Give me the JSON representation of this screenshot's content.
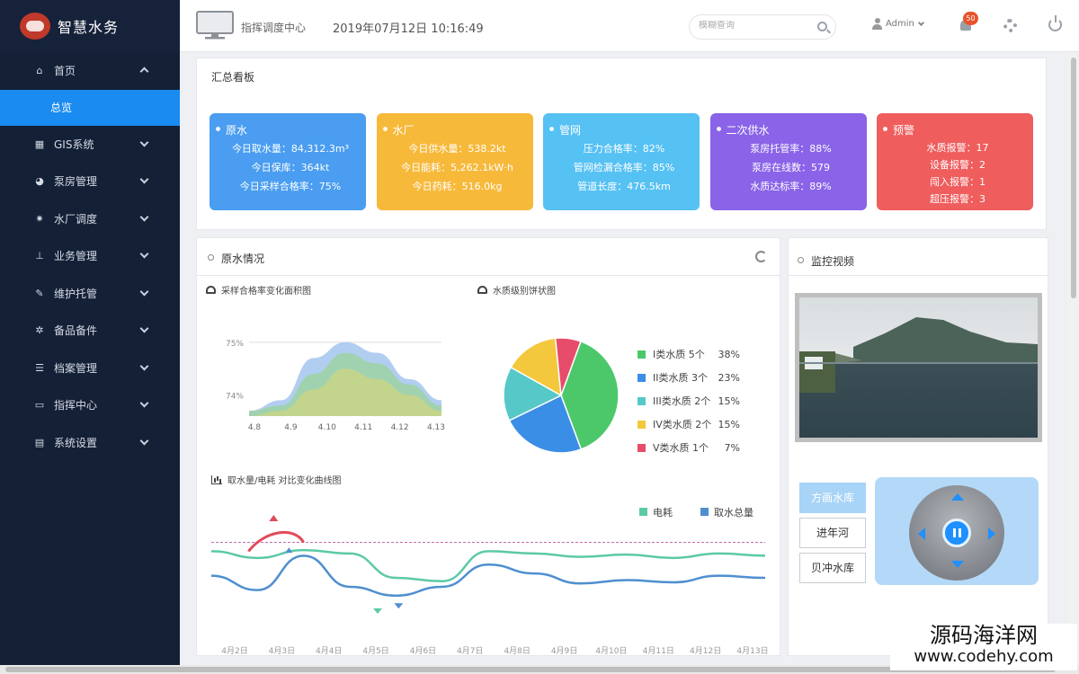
{
  "brand": {
    "title": "智慧水务"
  },
  "sidebar": {
    "items": [
      {
        "label": "首页",
        "icon": "home-icon",
        "expanded": true
      },
      {
        "label": "GIS系统",
        "icon": "grid-icon"
      },
      {
        "label": "泵房管理",
        "icon": "pie-icon"
      },
      {
        "label": "水厂调度",
        "icon": "cog-icon"
      },
      {
        "label": "业务管理",
        "icon": "sitemap-icon"
      },
      {
        "label": "维护托管",
        "icon": "edit-icon"
      },
      {
        "label": "备品备件",
        "icon": "cogs-icon"
      },
      {
        "label": "档案管理",
        "icon": "list-icon"
      },
      {
        "label": "指挥中心",
        "icon": "monitor-icon"
      },
      {
        "label": "系统设置",
        "icon": "calendar-icon"
      }
    ],
    "sub_active": "总览"
  },
  "topbar": {
    "center_name": "指挥调度中心",
    "datetime": "2019年07月12日 10:16:49",
    "search_placeholder": "模糊查询",
    "user": "Admin",
    "notifications": "50"
  },
  "summary": {
    "title": "汇总看板",
    "cards": [
      {
        "title": "原水",
        "color": "#4a9df0",
        "lines": [
          "今日取水量：84,312.3m³",
          "今日保库：364kt",
          "今日采样合格率：75%"
        ]
      },
      {
        "title": "水厂",
        "color": "#f7b93a",
        "lines": [
          "今日供水量：538.2kt",
          "今日能耗：5,262.1kW·h",
          "今日药耗：516.0kg"
        ]
      },
      {
        "title": "管网",
        "color": "#56c1f3",
        "lines": [
          "压力合格率：82%",
          "管网检漏合格率：85%",
          "管道长度：476.5km"
        ]
      },
      {
        "title": "二次供水",
        "color": "#8a63e8",
        "lines": [
          "泵房托管率：88%",
          "泵房在线数：579",
          "水质达标率：89%"
        ]
      },
      {
        "title": "预警",
        "color": "#ef5d5d",
        "lines": [
          "水质报警：17",
          "设备报警：2",
          "闯入报警：1",
          "超压报警：3"
        ]
      }
    ]
  },
  "raw_panel": {
    "title": "原水情况",
    "area_title": "采样合格率变化面积图",
    "pie_title": "水质级别饼状图",
    "line_title": "取水量/电耗 对比变化曲线图"
  },
  "video_panel": {
    "title": "监控视频",
    "video_overlay": "",
    "reservoirs": [
      "方画水库",
      "进年河",
      "贝冲水库"
    ],
    "active_reservoir": 0
  },
  "chart_data": [
    {
      "type": "area",
      "title": "采样合格率变化面积图",
      "categories": [
        "4.8",
        "4.9",
        "4.10",
        "4.11",
        "4.12",
        "4.13"
      ],
      "y_ticks": [
        "75%",
        "74%"
      ],
      "ylim": [
        73.6,
        75.1
      ],
      "series": [
        {
          "color": "#a8c9ef",
          "values": [
            73.7,
            73.9,
            74.7,
            75.0,
            74.8,
            74.3,
            73.9
          ]
        },
        {
          "color": "#9fd3a8",
          "values": [
            73.7,
            73.8,
            74.4,
            74.8,
            74.6,
            74.2,
            73.8
          ]
        },
        {
          "color": "#c7d48a",
          "values": [
            73.6,
            73.7,
            74.1,
            74.5,
            74.3,
            74.0,
            73.7
          ]
        }
      ]
    },
    {
      "type": "pie",
      "title": "水质级别饼状图",
      "slices": [
        {
          "label": "I类水质",
          "count": "5个",
          "percent": 38,
          "color": "#4cc86b"
        },
        {
          "label": "II类水质",
          "count": "3个",
          "percent": 23,
          "color": "#3a8ee6"
        },
        {
          "label": "III类水质",
          "count": "2个",
          "percent": 15,
          "color": "#56c8c8"
        },
        {
          "label": "IV类水质",
          "count": "2个",
          "percent": 15,
          "color": "#f4c83c"
        },
        {
          "label": "V类水质",
          "count": "1个",
          "percent": 7,
          "color": "#e74c6b"
        }
      ]
    },
    {
      "type": "line",
      "title": "取水量/电耗 对比变化曲线图",
      "categories": [
        "4月2日",
        "4月3日",
        "4月4日",
        "4月5日",
        "4月6日",
        "4月7日",
        "4月8日",
        "4月9日",
        "4月10日",
        "4月11日",
        "4月12日",
        "4月13日"
      ],
      "series": [
        {
          "name": "电耗",
          "color": "#5cc9a7",
          "values": [
            62,
            56,
            63,
            60,
            38,
            35,
            62,
            60,
            57,
            59,
            56,
            60,
            58
          ]
        },
        {
          "name": "取水总量",
          "color": "#4f8fd0",
          "values": [
            40,
            27,
            58,
            30,
            22,
            30,
            50,
            42,
            33,
            36,
            34,
            40,
            38
          ]
        }
      ],
      "threshold": 70
    }
  ],
  "watermark": {
    "line1": "源码海洋网",
    "line2": "www.codehy.com"
  }
}
